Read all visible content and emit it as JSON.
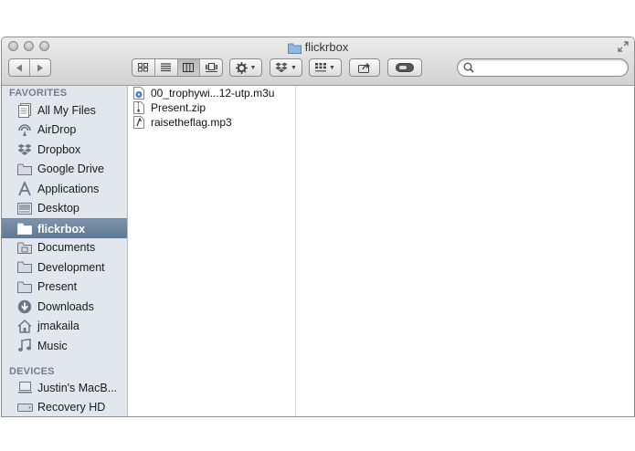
{
  "window": {
    "title": "flickrbox"
  },
  "toolbar": {
    "back_label": "back",
    "forward_label": "forward",
    "views": [
      "icon-view",
      "list-view",
      "column-view",
      "cover-flow-view"
    ],
    "active_view": "column-view",
    "action_icon": "gear-icon",
    "dropbox_icon": "dropbox-icon",
    "arrange_icon": "grid-icon",
    "share_icon": "share-icon",
    "tags_icon": "tag-icon",
    "search_placeholder": ""
  },
  "sidebar": {
    "favorites_heading": "FAVORITES",
    "favorites": [
      {
        "label": "All My Files",
        "icon": "all-files-icon"
      },
      {
        "label": "AirDrop",
        "icon": "airdrop-icon"
      },
      {
        "label": "Dropbox",
        "icon": "dropbox-icon"
      },
      {
        "label": "Google Drive",
        "icon": "folder-icon"
      },
      {
        "label": "Applications",
        "icon": "applications-icon"
      },
      {
        "label": "Desktop",
        "icon": "desktop-icon"
      },
      {
        "label": "flickrbox",
        "icon": "folder-icon"
      },
      {
        "label": "Documents",
        "icon": "documents-icon"
      },
      {
        "label": "Development",
        "icon": "folder-icon"
      },
      {
        "label": "Present",
        "icon": "folder-icon"
      },
      {
        "label": "Downloads",
        "icon": "downloads-icon"
      },
      {
        "label": "jmakaila",
        "icon": "home-icon"
      },
      {
        "label": "Music",
        "icon": "music-icon"
      }
    ],
    "selected": "flickrbox",
    "devices_heading": "DEVICES",
    "devices": [
      {
        "label": "Justin's MacB...",
        "icon": "laptop-icon"
      },
      {
        "label": "Recovery HD",
        "icon": "disk-icon"
      }
    ]
  },
  "columns": [
    {
      "files": [
        {
          "name": "00_trophywi...12-utp.m3u",
          "icon": "playlist-file-icon"
        },
        {
          "name": "Present.zip",
          "icon": "zip-file-icon"
        },
        {
          "name": "raisetheflag.mp3",
          "icon": "audio-file-icon"
        }
      ]
    }
  ]
}
